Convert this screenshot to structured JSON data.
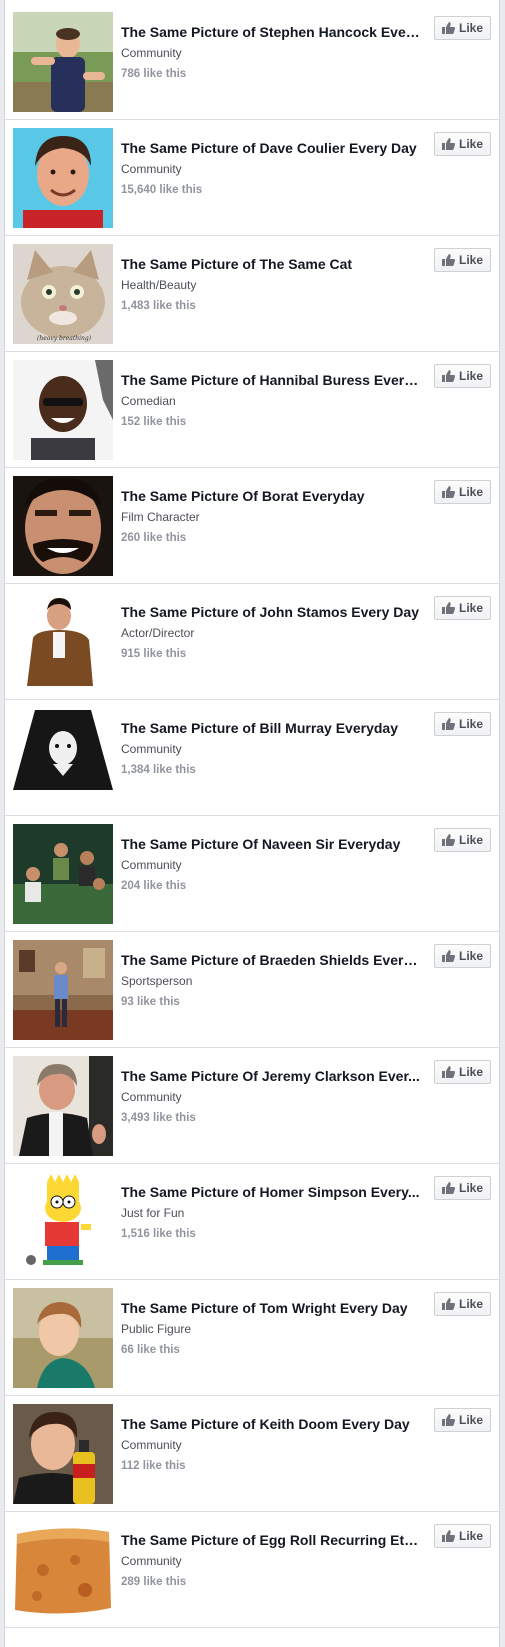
{
  "like_label": "Like",
  "colors": {
    "title": "#141823",
    "meta": "#90949c",
    "separator": "#dddfe2"
  },
  "pages": [
    {
      "id": "hancock",
      "title": "The Same Picture of Stephen Hancock Ever...",
      "category": "Community",
      "likes": "786 like this"
    },
    {
      "id": "coulier",
      "title": "The Same Picture of Dave Coulier Every Day",
      "category": "Community",
      "likes": "15,640 like this"
    },
    {
      "id": "cat",
      "title": "The Same Picture of The Same Cat",
      "category": "Health/Beauty",
      "likes": "1,483 like this",
      "image_caption": "(heavy breathing)"
    },
    {
      "id": "buress",
      "title": "The Same Picture of Hannibal Buress Every...",
      "category": "Comedian",
      "likes": "152 like this"
    },
    {
      "id": "borat",
      "title": "The Same Picture Of Borat Everyday",
      "category": "Film Character",
      "likes": "260 like this"
    },
    {
      "id": "stamos",
      "title": "The Same Picture of John Stamos Every Day",
      "category": "Actor/Director",
      "likes": "915 like this"
    },
    {
      "id": "murray",
      "title": "The Same Picture of Bill Murray Everyday",
      "category": "Community",
      "likes": "1,384 like this"
    },
    {
      "id": "naveen",
      "title": "The Same Picture Of Naveen Sir Everyday",
      "category": "Community",
      "likes": "204 like this"
    },
    {
      "id": "braeden",
      "title": "The Same Picture of Braeden Shields Every...",
      "category": "Sportsperson",
      "likes": "93 like this"
    },
    {
      "id": "clarkson",
      "title": "The Same Picture Of Jeremy Clarkson Ever...",
      "category": "Community",
      "likes": "3,493 like this"
    },
    {
      "id": "simpson",
      "title": "The Same Picture of Homer Simpson Every...",
      "category": "Just for Fun",
      "likes": "1,516 like this"
    },
    {
      "id": "wright",
      "title": "The Same Picture of Tom Wright Every Day",
      "category": "Public Figure",
      "likes": "66 like this"
    },
    {
      "id": "doom",
      "title": "The Same Picture of Keith Doom Every Day",
      "category": "Community",
      "likes": "112 like this"
    },
    {
      "id": "eggroll",
      "title": "The Same Picture of Egg Roll Recurring Ete...",
      "category": "Community",
      "likes": "289 like this"
    }
  ]
}
